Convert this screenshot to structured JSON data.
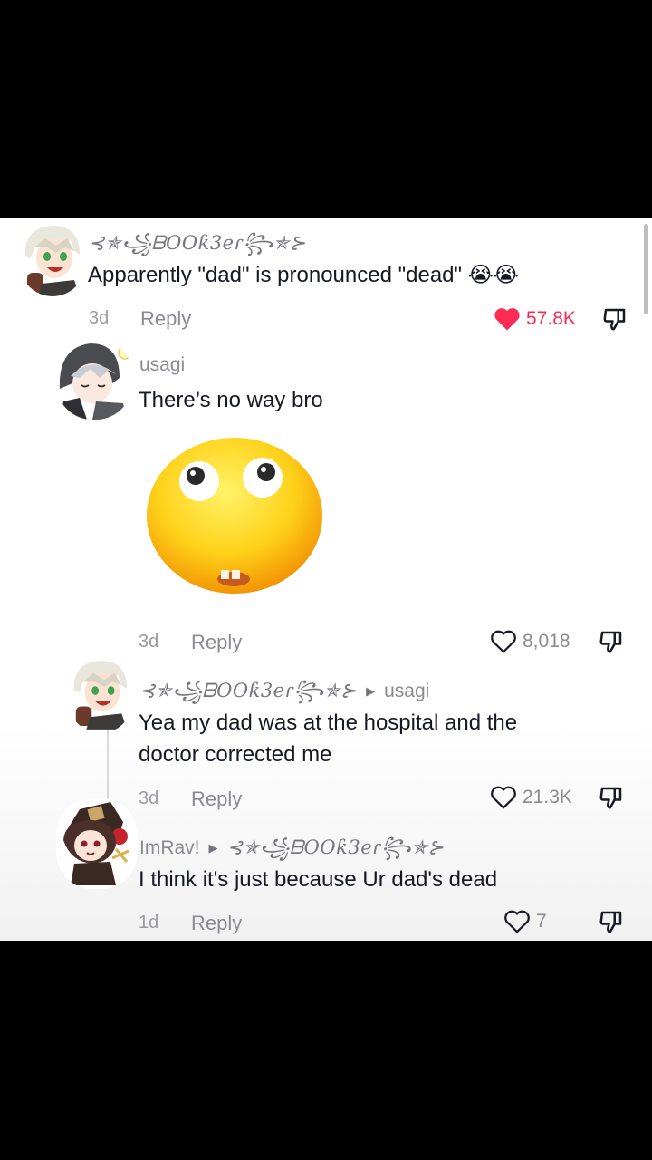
{
  "comments": [
    {
      "username": "⊰✯꧁ᗷOOƙ3eɾ꧂✯⊱",
      "text": "Apparently \"dad\" is pronounced \"dead\" 😭😭",
      "time": "3d",
      "reply_label": "Reply",
      "likes": "57.8K",
      "liked": true
    },
    {
      "username": "usagi",
      "text": "There’s no way bro",
      "sticker": "shocked-emoji-sticker",
      "time": "3d",
      "reply_label": "Reply",
      "likes": "8,018",
      "liked": false
    },
    {
      "username": "⊰✯꧁ᗷOOƙ3eɾ꧂✯⊱",
      "reply_to": "usagi",
      "text_line1": "Yea my dad was at the hospital and the",
      "text_line2": "doctor corrected me",
      "time": "3d",
      "reply_label": "Reply",
      "likes": "21.3K",
      "liked": false
    },
    {
      "username": "ImRav!",
      "reply_to": "⊰✯꧁ᗷOOƙ3eɾ꧂✯⊱",
      "text": "I think it's just because Ur dad's dead",
      "time": "1d",
      "reply_label": "Reply",
      "likes": "7",
      "liked": false
    }
  ],
  "colors": {
    "like_active": "#fe2c55",
    "muted": "#8a8b91",
    "text": "#161823"
  }
}
